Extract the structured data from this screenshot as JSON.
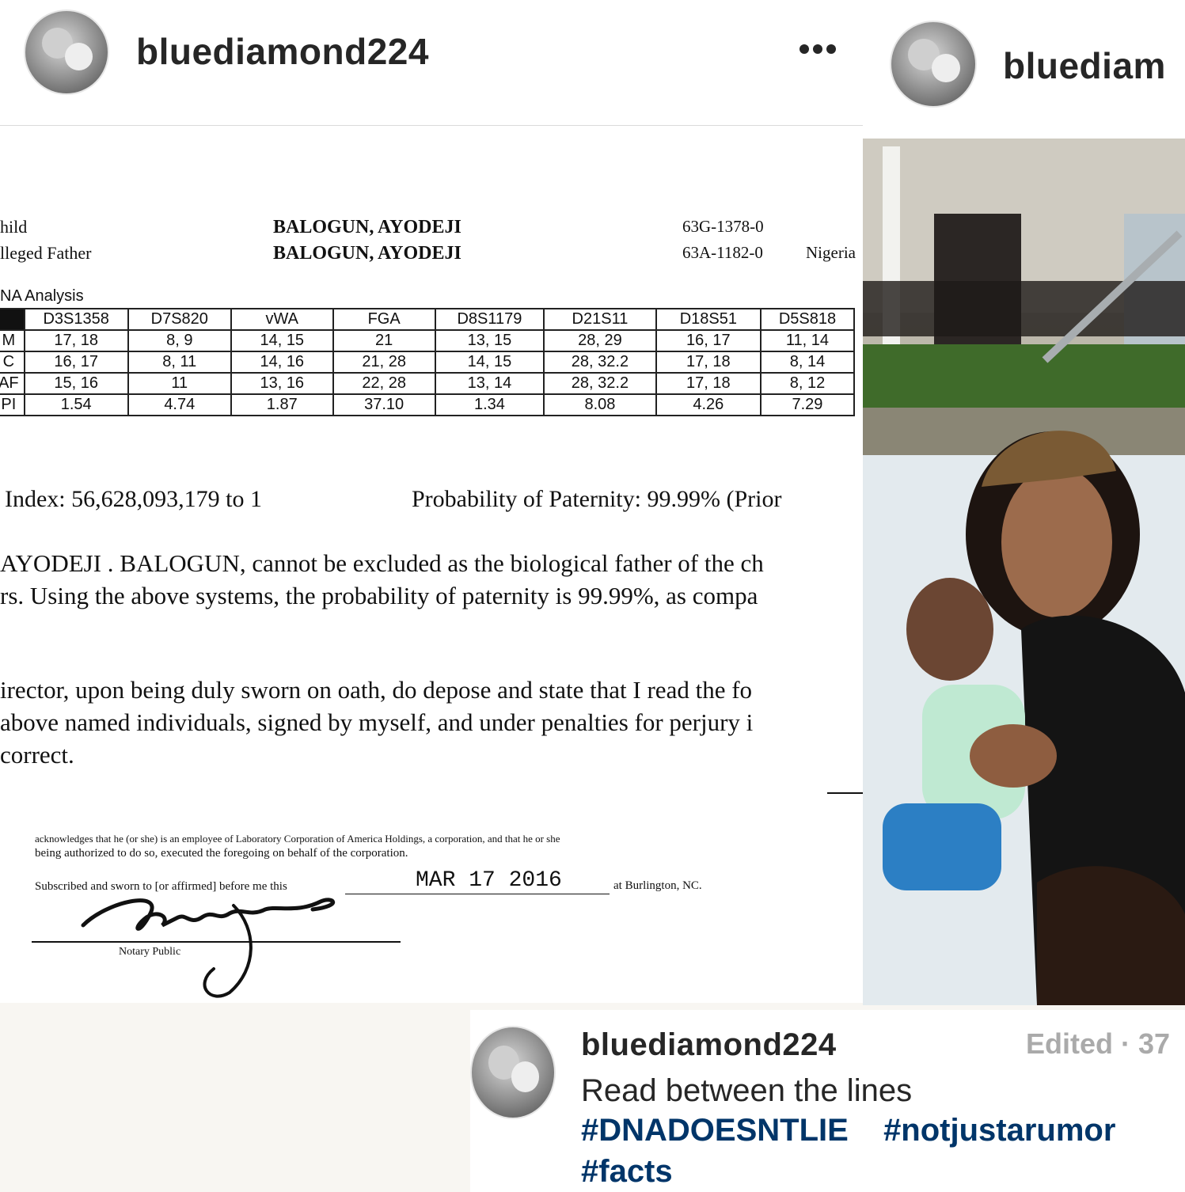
{
  "left_post": {
    "username": "bluediamond224",
    "more_icon": "ellipsis-icon"
  },
  "right_post": {
    "username": "bluediam"
  },
  "document": {
    "row1_label": "hild",
    "row1_name": "BALOGUN, AYODEJI",
    "row1_code": "63G-1378-0",
    "row2_label": "lleged Father",
    "row2_name": "BALOGUN, AYODEJI",
    "row2_code": "63A-1182-0",
    "row2_country": "Nigeria",
    "section_label": "NA Analysis",
    "table": {
      "headers": [
        "",
        "D3S1358",
        "D7S820",
        "vWA",
        "FGA",
        "D8S1179",
        "D21S11",
        "D18S51",
        "D5S818"
      ],
      "rows": [
        [
          "M",
          "17, 18",
          "8, 9",
          "14, 15",
          "21",
          "13, 15",
          "28, 29",
          "16, 17",
          "11, 14"
        ],
        [
          "C",
          "16, 17",
          "8, 11",
          "14, 16",
          "21, 28",
          "14, 15",
          "28, 32.2",
          "17, 18",
          "8, 14"
        ],
        [
          "AF",
          "15, 16",
          "11",
          "13, 16",
          "22, 28",
          "13, 14",
          "28, 32.2",
          "17, 18",
          "8, 12"
        ],
        [
          "PI",
          "1.54",
          "4.74",
          "1.87",
          "37.10",
          "1.34",
          "8.08",
          "4.26",
          "7.29"
        ]
      ]
    },
    "index_line": "Index:  56,628,093,179 to 1",
    "probability_line": "Probability of Paternity:  99.99% (Prior",
    "para1_line1": "AYODEJI . BALOGUN, cannot be excluded as the biological father of the ch",
    "para1_line2": "rs.  Using the above systems, the probability of paternity is 99.99%, as compa",
    "para2_line1": "irector, upon being duly sworn on oath, do depose and state that I read the fo",
    "para2_line2": "above named individuals, signed by myself, and under penalties for perjury i",
    "para2_line3": "correct.",
    "ack_line1": "acknowledges that he (or she) is an employee of Laboratory Corporation of America Holdings, a corporation, and that he or she",
    "ack_line2": "being authorized to do so, executed the foregoing on behalf of the corporation.",
    "subscribed_label": "Subscribed and sworn to [or affirmed] before me this",
    "stamp_date": "MAR 17 2016",
    "location": "at Burlington, NC.",
    "notary_label": "Notary Public"
  },
  "caption": {
    "username": "bluediamond224",
    "meta": "Edited · 37",
    "text": "Read between the lines",
    "hashtags": [
      "#DNADOESNTLIE",
      "#notjustarumor",
      "#facts"
    ]
  }
}
